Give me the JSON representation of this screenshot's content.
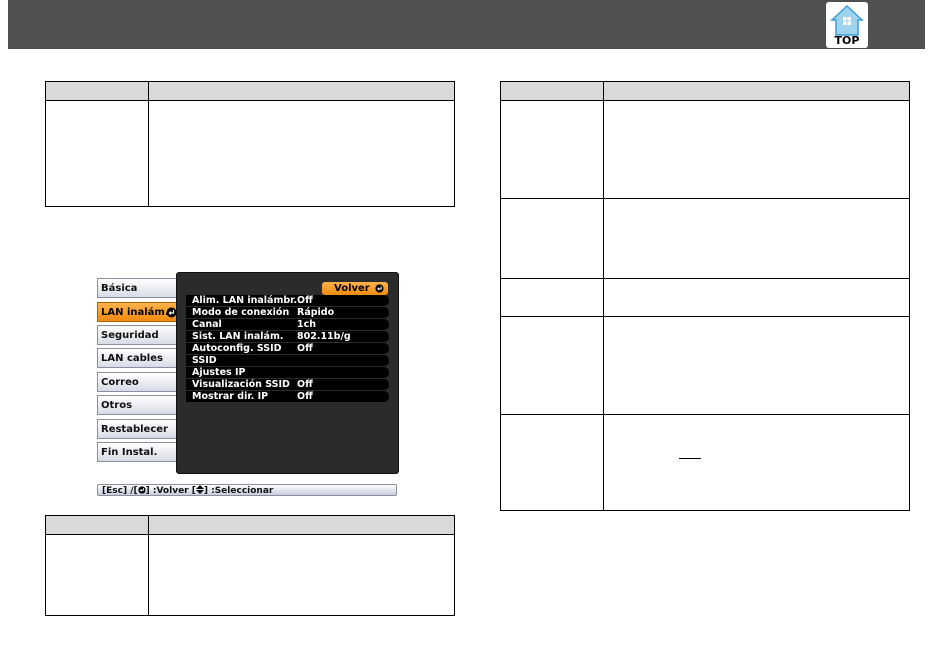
{
  "header": {
    "top_icon_label": "TOP",
    "top_icon": "house-icon"
  },
  "menu": {
    "tabs": [
      {
        "label": "Básica",
        "active": false
      },
      {
        "label": "LAN inalám.",
        "active": true
      },
      {
        "label": "Seguridad",
        "active": false
      },
      {
        "label": "LAN cables",
        "active": false
      },
      {
        "label": "Correo",
        "active": false
      },
      {
        "label": "Otros",
        "active": false
      },
      {
        "label": "Restablecer",
        "active": false
      },
      {
        "label": "Fin Instal.",
        "active": false
      }
    ],
    "back_label": "Volver",
    "rows": [
      {
        "label": "Alim. LAN inalámbr.",
        "value": "Off"
      },
      {
        "label": "Modo de conexión",
        "value": "Rápido"
      },
      {
        "label": "Canal",
        "value": "1ch"
      },
      {
        "label": "Sist. LAN inalám.",
        "value": "802.11b/g"
      },
      {
        "label": "Autoconfig. SSID",
        "value": "Off"
      },
      {
        "label": "SSID",
        "value": ""
      },
      {
        "label": "Ajustes IP",
        "value": ""
      },
      {
        "label": "Visualización SSID",
        "value": "Off"
      },
      {
        "label": "Mostrar dir. IP",
        "value": "Off"
      }
    ],
    "help_bar": {
      "part1": "[Esc] /[",
      "part2": "] :Volver  [",
      "part3": "] :Seleccionar"
    }
  },
  "colors": {
    "header_bar": "#505050",
    "table_header": "#d9d9d9",
    "accent_orange": "#f08a10",
    "menu_panel": "#2b2b2b"
  }
}
